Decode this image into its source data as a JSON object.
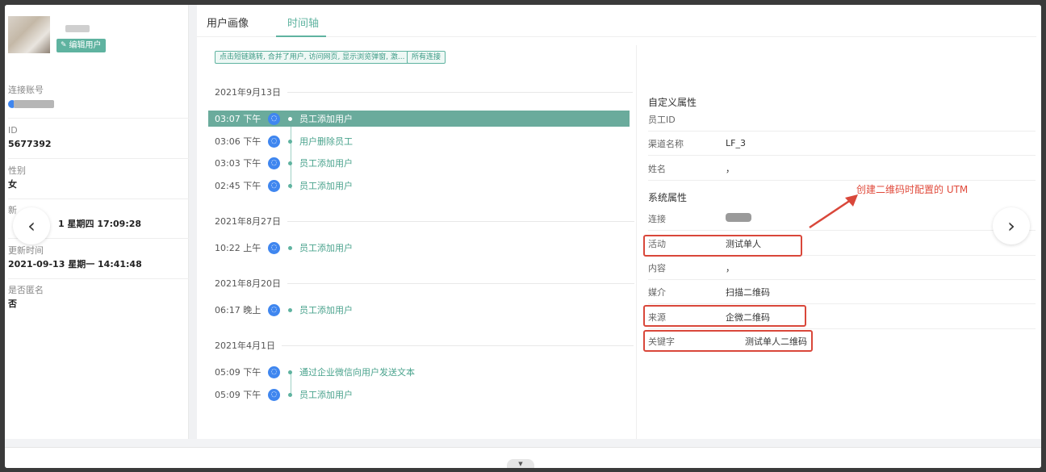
{
  "profile": {
    "edit_label": "编辑用户",
    "fields": [
      {
        "label": "连接账号",
        "value": ""
      },
      {
        "label": "ID",
        "value": "5677392"
      },
      {
        "label": "性别",
        "value": "女"
      },
      {
        "label": "新",
        "value": "1 星期四 17:09:28"
      },
      {
        "label": "更新时间",
        "value": "2021-09-13 星期一 14:41:48"
      },
      {
        "label": "是否匿名",
        "value": "否"
      }
    ]
  },
  "nav": {
    "prev": "‹",
    "next": "›"
  },
  "tabs": [
    {
      "label": "用户画像"
    },
    {
      "label": "时间轴"
    }
  ],
  "filters": [
    "点击短链跳转, 合并了用户, 访问网页, 显示浏览弹窗, 激...",
    "所有连接"
  ],
  "timeline": [
    {
      "date": "2021年9月13日",
      "events": [
        {
          "time": "03:07 下午",
          "text": "员工添加用户",
          "selected": true
        },
        {
          "time": "03:06 下午",
          "text": "用户删除员工"
        },
        {
          "time": "03:03 下午",
          "text": "员工添加用户"
        },
        {
          "time": "02:45 下午",
          "text": "员工添加用户"
        }
      ]
    },
    {
      "date": "2021年8月27日",
      "events": [
        {
          "time": "10:22 上午",
          "text": "员工添加用户"
        }
      ]
    },
    {
      "date": "2021年8月20日",
      "events": [
        {
          "time": "06:17 晚上",
          "text": "员工添加用户"
        }
      ]
    },
    {
      "date": "2021年4月1日",
      "events": [
        {
          "time": "05:09 下午",
          "text": "通过企业微信向用户发送文本"
        },
        {
          "time": "05:09 下午",
          "text": "员工添加用户"
        }
      ]
    }
  ],
  "custom_props": {
    "title": "自定义属性",
    "rows": [
      {
        "key": "员工ID",
        "value": ""
      },
      {
        "key": "渠道名称",
        "value": "LF_3"
      },
      {
        "key": "姓名",
        "value": "，"
      }
    ]
  },
  "system_props": {
    "title": "系统属性",
    "rows": [
      {
        "key": "连接",
        "value": ""
      },
      {
        "key": "活动",
        "value": "测试单人"
      },
      {
        "key": "内容",
        "value": "，"
      },
      {
        "key": "媒介",
        "value": "扫描二维码"
      },
      {
        "key": "来源",
        "value": "企微二维码"
      },
      {
        "key": "关键字",
        "value": "测试单人二维码"
      }
    ]
  },
  "annotation": "创建二维码时配置的 UTM",
  "colors": {
    "accent": "#5fb3a0",
    "selected_row": "#6aab9c",
    "annotation": "#d9473a",
    "channel_icon": "#3f86ef"
  }
}
